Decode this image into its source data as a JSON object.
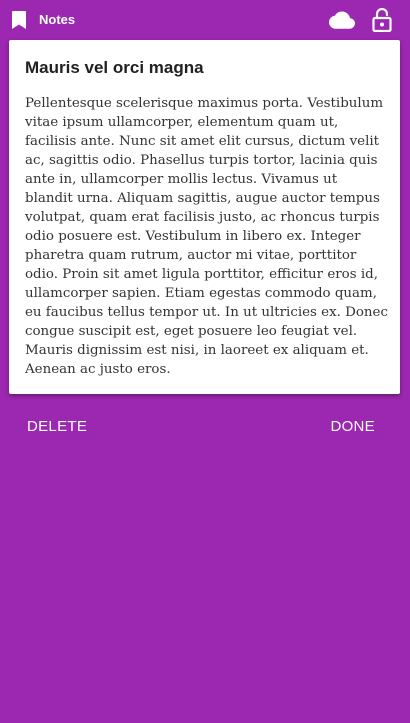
{
  "app": {
    "title": "Notes",
    "icons": {
      "bookmark": "bookmark-icon",
      "cloud": "cloud-icon",
      "lock": "lock-open-icon"
    },
    "colors": {
      "background": "#9c27b0",
      "card": "#ffffff",
      "title_text": "#212121",
      "body_text": "#333333",
      "spellcheck": "#e53935"
    }
  },
  "note": {
    "title": "Mauris vel orci magna",
    "body": "Pellentesque scelerisque maximus porta. Vestibulum vitae ipsum ullamcorper, elementum quam ut, facilisis ante. Nunc sit amet elit cursus, dictum velit ac, sagittis odio. Phasellus turpis tortor, lacinia quis ante in, ullamcorper mollis lectus. Vivamus ut blandit urna. Aliquam sagittis, augue auctor tempus volutpat, quam erat facilisis justo, ac rhoncus turpis odio posuere est. Vestibulum in libero ex. Integer pharetra quam rutrum, auctor mi vitae, porttitor odio. Proin sit amet ligula porttitor, efficitur eros id, ullamcorper sapien. Etiam egestas commodo quam, eu faucibus tellus tempor ut. In ut ultricies ex. Donec congue suscipit est, eget posuere leo feugiat vel. Mauris dignissim est nisi, in laoreet ex aliquam et. Aenean ac justo eros."
  },
  "actions": {
    "delete_label": "DELETE",
    "done_label": "DONE"
  }
}
